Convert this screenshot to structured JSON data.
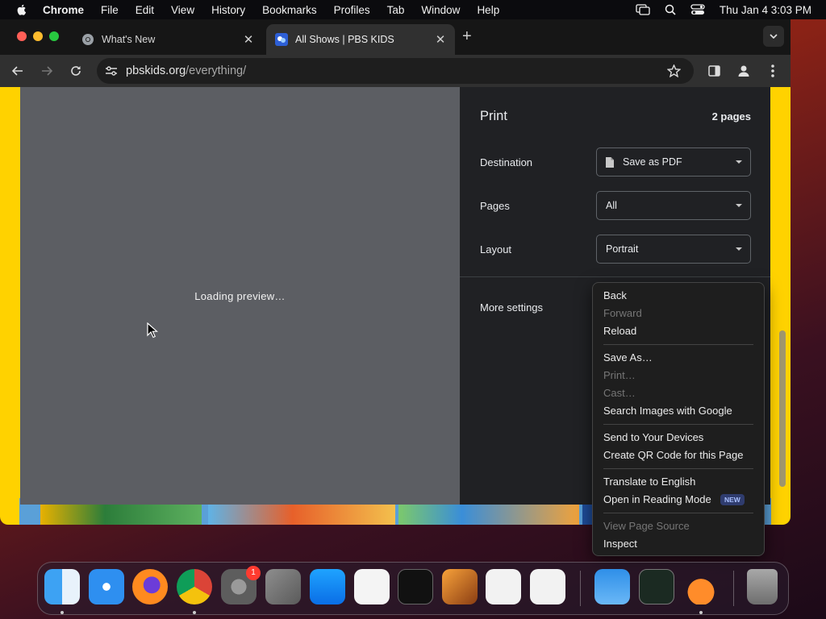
{
  "menubar": {
    "app_name": "Chrome",
    "items": [
      "File",
      "Edit",
      "View",
      "History",
      "Bookmarks",
      "Profiles",
      "Tab",
      "Window",
      "Help"
    ],
    "clock": "Thu Jan 4  3:03 PM"
  },
  "tabs": [
    {
      "title": "What's New",
      "icon": "chrome-icon"
    },
    {
      "title": "All Shows | PBS KIDS",
      "icon": "pbs-kids-icon"
    }
  ],
  "address_bar": {
    "host": "pbskids.org",
    "path": "/everything/"
  },
  "preview": {
    "loading_text": "Loading preview…"
  },
  "print_panel": {
    "title": "Print",
    "page_count": "2 pages",
    "destination_label": "Destination",
    "destination_value": "Save as PDF",
    "pages_label": "Pages",
    "pages_value": "All",
    "layout_label": "Layout",
    "layout_value": "Portrait",
    "more_settings_label": "More settings"
  },
  "context_menu": {
    "back": "Back",
    "forward": "Forward",
    "reload": "Reload",
    "save_as": "Save As…",
    "print": "Print…",
    "cast": "Cast…",
    "search_images": "Search Images with Google",
    "send_to_devices": "Send to Your Devices",
    "create_qr": "Create QR Code for this Page",
    "translate": "Translate to English",
    "reading_mode": "Open in Reading Mode",
    "new_badge": "NEW",
    "view_source": "View Page Source",
    "inspect": "Inspect"
  },
  "dock": {
    "apps": [
      "finder-icon",
      "safari-icon",
      "firefox-icon",
      "chrome-icon",
      "system-settings-icon",
      "launchpad-icon",
      "app-store-icon",
      "textedit-icon",
      "terminal-icon",
      "garageband-icon",
      "visual-studio-icon",
      "vscode-icon",
      "weather-icon",
      "activity-monitor-icon",
      "flask-app-icon",
      "trash-icon"
    ],
    "settings_badge": "1"
  },
  "colors": {
    "page_background": "#ffd200",
    "print_panel": "#202124",
    "preview_area": "#5c5e63"
  }
}
